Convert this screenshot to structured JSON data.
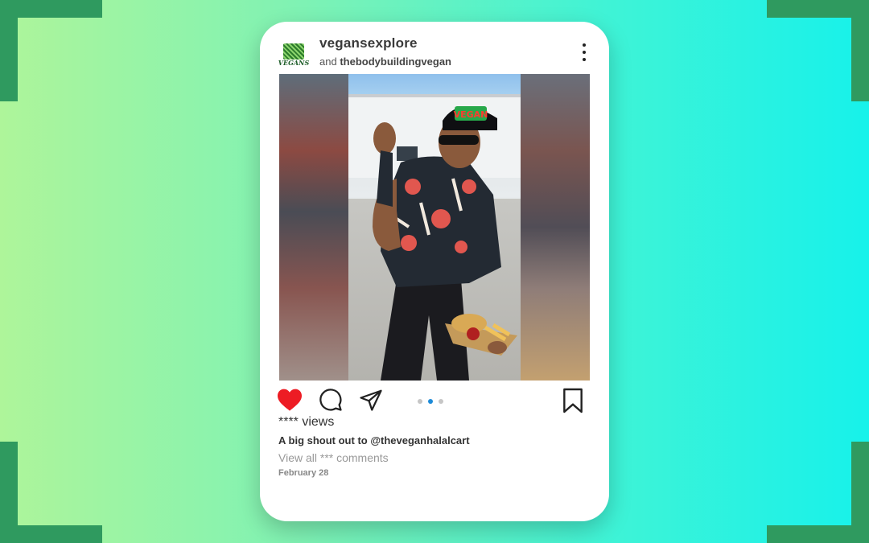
{
  "colors": {
    "accent_like": "#ED1C24",
    "dot_active": "#1E8BD8",
    "frame_corners": "#2F9A5F"
  },
  "post": {
    "username": "vegansexplore",
    "collab_prefix": "and",
    "collab_user": "thebodybuildingvegan",
    "avatar_logo_text": "VEGANS",
    "more_icon": "more-vertical-icon",
    "media": {
      "carousel_total": 3,
      "carousel_active_index": 2
    },
    "actions": {
      "like_icon": "heart-filled-icon",
      "comment_icon": "comment-icon",
      "share_icon": "send-icon",
      "save_icon": "bookmark-icon",
      "liked": true
    },
    "views": "**** views",
    "caption": "A big shout out to @theveganhalalcart",
    "view_all_comments": "View all *** comments",
    "date": "February 28"
  },
  "photo_overlay": {
    "cap_text": "VEGAN"
  }
}
